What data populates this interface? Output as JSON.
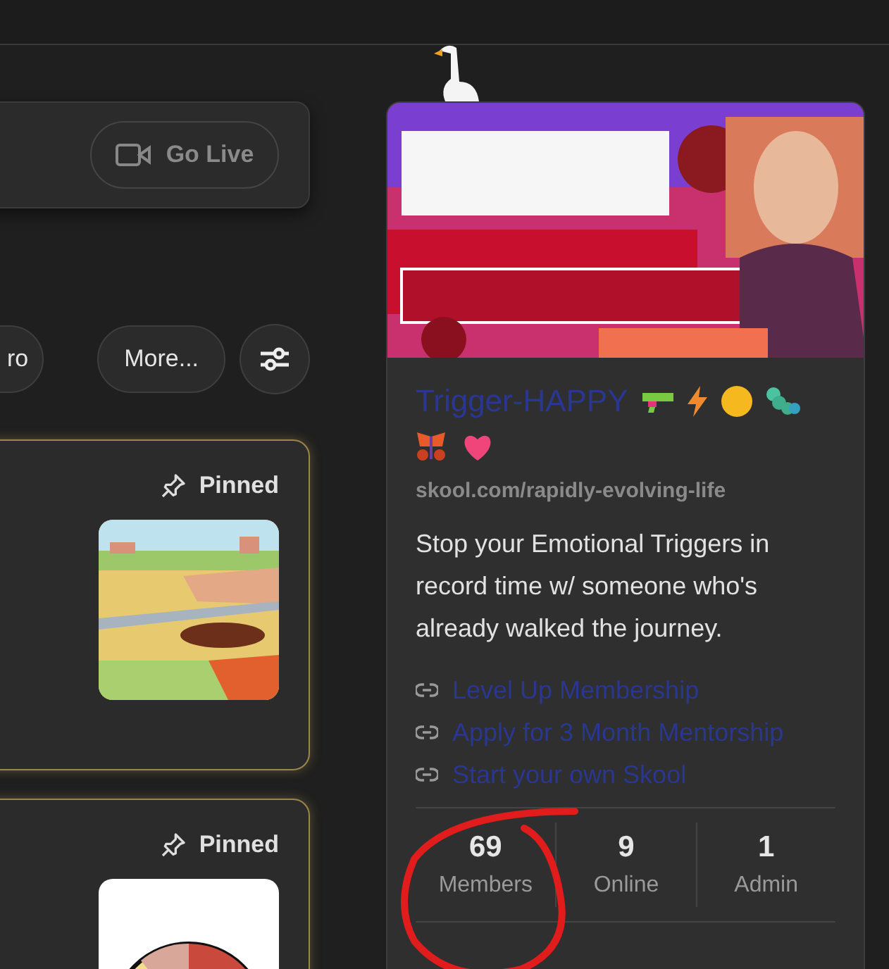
{
  "live_card": {
    "button": "Go Live"
  },
  "filters": [
    "ro",
    "More..."
  ],
  "posts": [
    {
      "pinned": true,
      "pinned_label": "Pinned"
    },
    {
      "pinned": true,
      "pinned_label": "Pinned"
    }
  ],
  "group": {
    "title": "Trigger-HAPPY",
    "url": "skool.com/rapidly-evolving-life",
    "description": "Stop your Emotional Triggers in record time w/ someone who's already walked the journey.",
    "links": [
      "Level Up Membership",
      "Apply for 3 Month Mentorship",
      "Start your own Skool"
    ],
    "stats": [
      {
        "value": "69",
        "label": "Members"
      },
      {
        "value": "9",
        "label": "Online"
      },
      {
        "value": "1",
        "label": "Admin"
      }
    ]
  }
}
